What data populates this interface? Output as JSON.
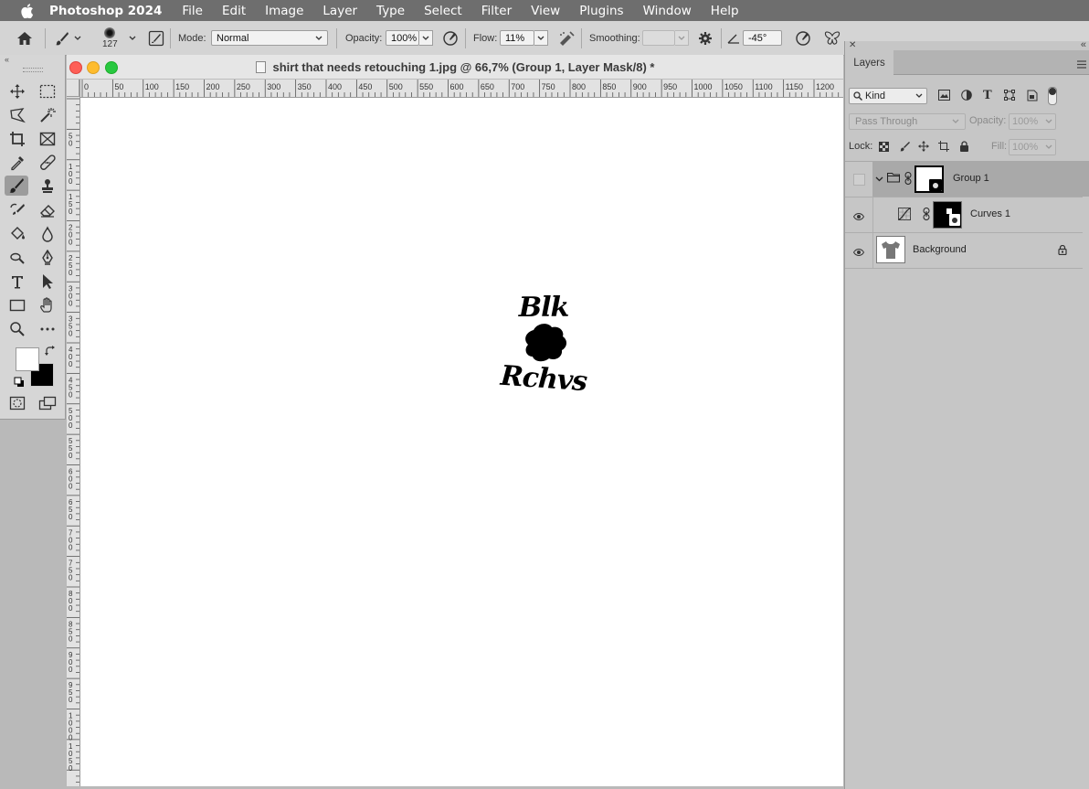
{
  "menubar": {
    "app_name": "Photoshop 2024",
    "items": [
      "File",
      "Edit",
      "Image",
      "Layer",
      "Type",
      "Select",
      "Filter",
      "View",
      "Plugins",
      "Window",
      "Help"
    ]
  },
  "options_bar": {
    "brush_size": "127",
    "mode_label": "Mode:",
    "mode_value": "Normal",
    "opacity_label": "Opacity:",
    "opacity_value": "100%",
    "flow_label": "Flow:",
    "flow_value": "11%",
    "smoothing_label": "Smoothing:",
    "smoothing_value": "",
    "angle_value": "-45°"
  },
  "document": {
    "title": "shirt that needs retouching 1.jpg @ 66,7% (Group 1, Layer Mask/8) *",
    "ruler_h_labels": [
      "0",
      "50",
      "100",
      "150",
      "200",
      "250",
      "300",
      "350",
      "400",
      "450",
      "500",
      "550",
      "600",
      "650",
      "700",
      "750",
      "800",
      "850",
      "900",
      "950",
      "1000",
      "1050",
      "1100",
      "1150",
      "1200"
    ],
    "ruler_v_labels": [
      "50",
      "100",
      "150",
      "200",
      "250",
      "300",
      "350",
      "400",
      "450",
      "500",
      "550",
      "600",
      "650",
      "700",
      "750",
      "800",
      "850",
      "900",
      "950",
      "1000",
      "1050"
    ],
    "artwork_text_top": "Blk",
    "artwork_text_bottom": "Rchvs"
  },
  "layers_panel": {
    "tab_label": "Layers",
    "filter_kind": "Kind",
    "blend_mode": "Pass Through",
    "opacity_label": "Opacity:",
    "opacity_value": "100%",
    "lock_label": "Lock:",
    "fill_label": "Fill:",
    "fill_value": "100%",
    "layers": [
      {
        "name": "Group 1",
        "visible": false,
        "selected": true
      },
      {
        "name": "Curves 1",
        "visible": true,
        "selected": false
      },
      {
        "name": "Background",
        "visible": true,
        "locked": true
      }
    ]
  },
  "colors": {
    "accent_selected_row": "#a9a9a9",
    "traffic_close": "#fe5f57",
    "traffic_minimize": "#febc2e",
    "traffic_zoom": "#28c840"
  }
}
